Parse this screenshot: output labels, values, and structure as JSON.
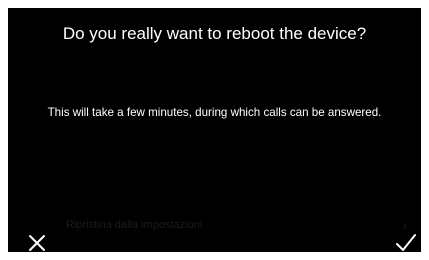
{
  "dialog": {
    "title": "Do you really want to reboot the device?",
    "message": "This will take a few minutes, during which calls can be answered."
  },
  "background": {
    "faded_item_label": "Ripristina dalla impostazioni",
    "faded_item_chevron": "›"
  },
  "actions": {
    "cancel_icon": "close-icon",
    "confirm_icon": "checkmark-icon"
  },
  "colors": {
    "screen_background": "#000000",
    "text": "#ffffff",
    "faded_text": "#1c1c1c"
  }
}
